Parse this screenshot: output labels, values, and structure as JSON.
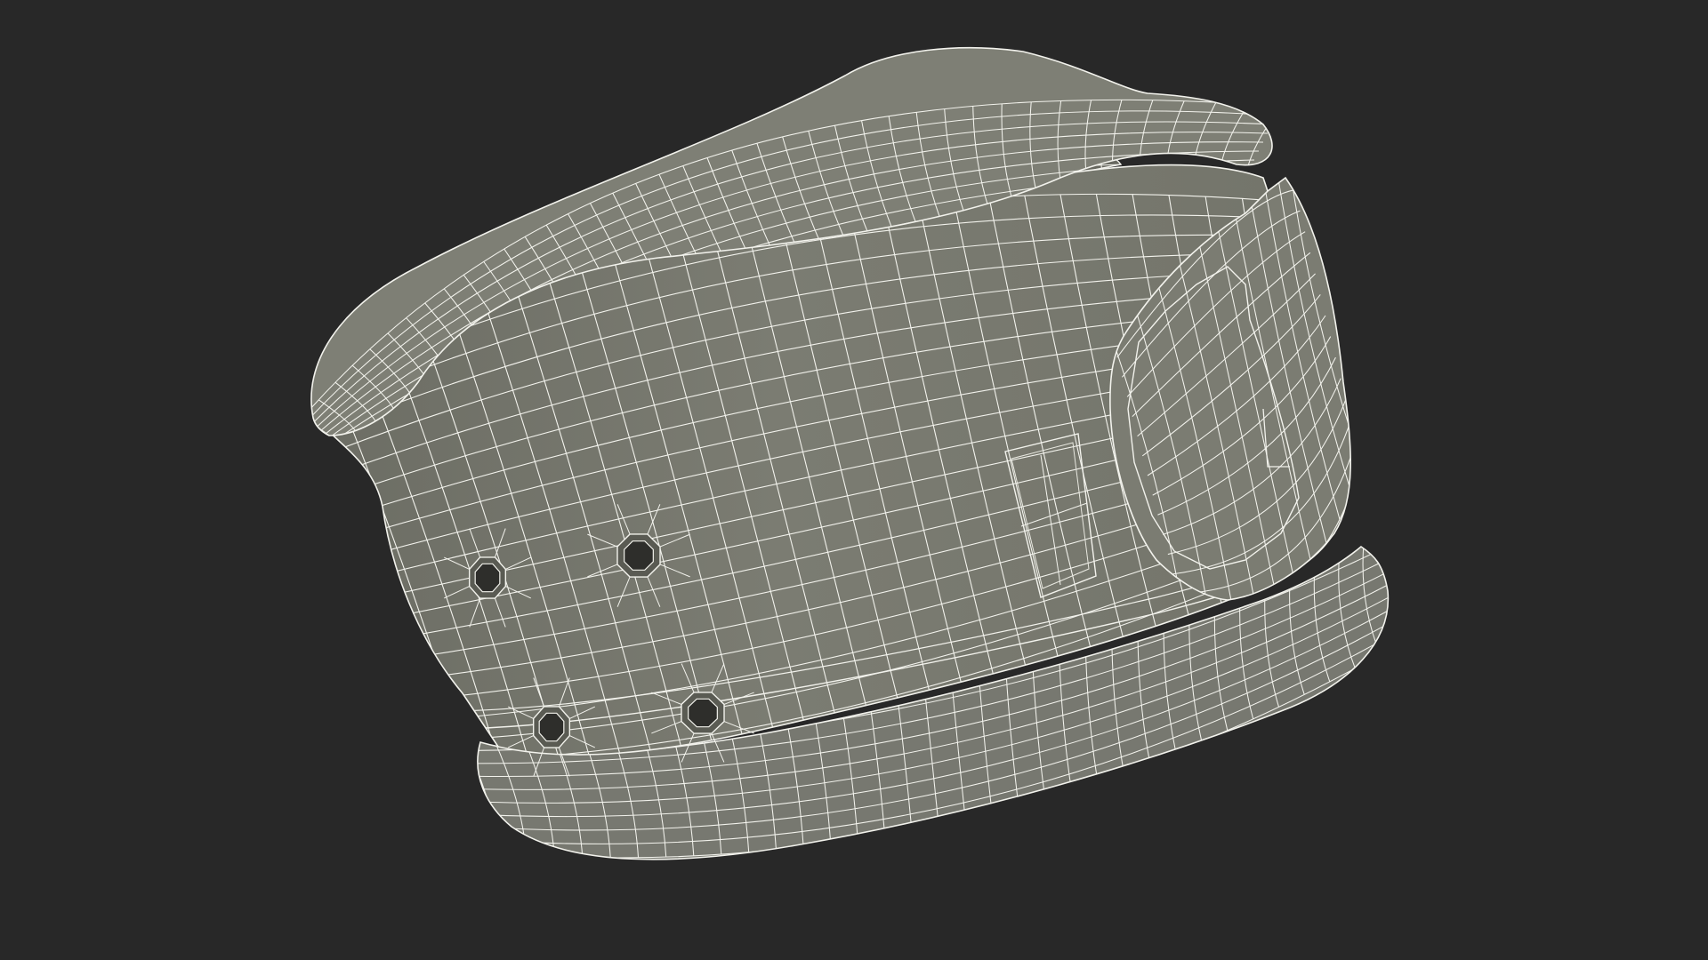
{
  "scene": {
    "background_color": "#282828",
    "object": {
      "type": "cervical-collar",
      "render_style": "wireframe-over-shaded",
      "surface_color": "#7a7b71",
      "inner_surface_color": "#66675e",
      "shadow_color": "#5e5f56",
      "wire_color": "#f2f2ec",
      "features": [
        "rolled-top-rim",
        "inner-lining",
        "ventilation-holes",
        "velcro-strap-tab",
        "rectangular-patch",
        "bottom-flared-rim"
      ],
      "ventilation_hole_count": 4
    }
  }
}
